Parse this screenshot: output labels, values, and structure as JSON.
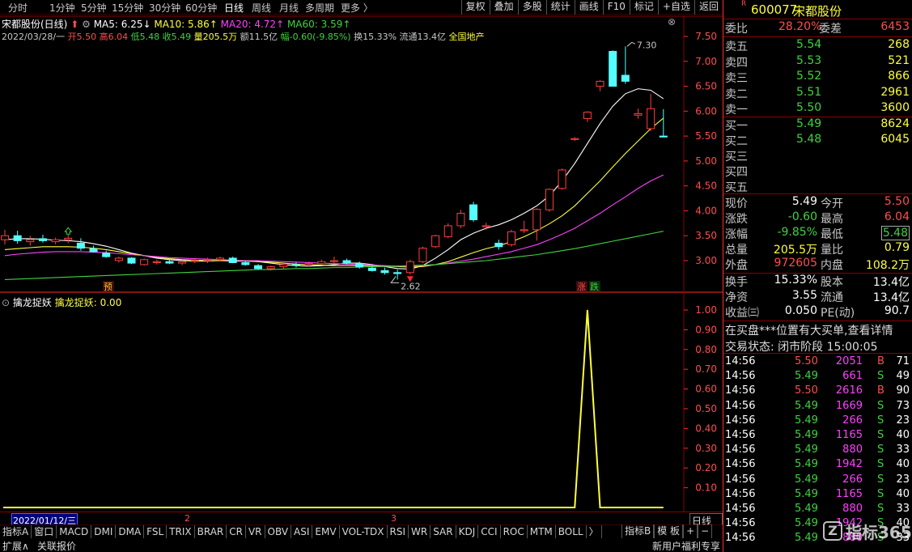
{
  "top_menu": {
    "items": [
      {
        "label": "分时"
      },
      {
        "label": "1分钟"
      },
      {
        "label": "5分钟"
      },
      {
        "label": "15分钟"
      },
      {
        "label": "30分钟"
      },
      {
        "label": "60分钟"
      },
      {
        "label": "日线"
      },
      {
        "label": "周线"
      },
      {
        "label": "月线"
      },
      {
        "label": "多周期"
      },
      {
        "label": "更多 〉"
      }
    ],
    "active": "日线",
    "buttons": [
      {
        "label": "复权"
      },
      {
        "label": "叠加"
      },
      {
        "label": "多股"
      },
      {
        "label": "统计"
      },
      {
        "label": "画线"
      },
      {
        "label": "F10"
      },
      {
        "label": "标记"
      },
      {
        "label": "+自选"
      },
      {
        "label": "返回"
      }
    ]
  },
  "stock_line": {
    "name": "宋都股份(日线)",
    "ma5": "MA5: 6.25↓",
    "ma10": "MA10: 5.86↑",
    "ma20": "MA20: 4.72↑",
    "ma60": "MA60: 3.59↑"
  },
  "ohlc_line": {
    "date": "2022/03/28/一",
    "open": "开5.50",
    "high": "高6.04",
    "low": "低5.48",
    "close": "收5.49",
    "volume": "量205.5万",
    "amount": "额11.5亿",
    "change": "幅-0.60(-9.85%)",
    "turnover": "换15.33%",
    "float": "流通13.4亿",
    "sector": "全国地产"
  },
  "price_axis": [
    "7.50",
    "7.00",
    "6.50",
    "6.00",
    "5.50",
    "5.00",
    "4.50",
    "4.00",
    "3.50",
    "3.00"
  ],
  "chart_labels": {
    "high": "7.30",
    "low": "2.62",
    "mark_pre": "预",
    "mark_zhang": "涨",
    "mark_die": "跌"
  },
  "indicator": {
    "title": "擒龙捉妖",
    "name": "擒龙捉妖:",
    "value": "0.00"
  },
  "indicator_axis": [
    "1.00",
    "0.90",
    "0.80",
    "0.70",
    "0.60",
    "0.50",
    "0.40",
    "0.30",
    "0.20",
    "0.10"
  ],
  "date_axis": {
    "cursor_date": "2022/01/12/三",
    "m2": "2",
    "m3": "3",
    "period": "日线板"
  },
  "tabs": [
    {
      "label": "指标A"
    },
    {
      "label": "窗口"
    },
    {
      "label": "MACD"
    },
    {
      "label": "DMI"
    },
    {
      "label": "DMA"
    },
    {
      "label": "FSL"
    },
    {
      "label": "TRIX"
    },
    {
      "label": "BRAR"
    },
    {
      "label": "CR"
    },
    {
      "label": "VR"
    },
    {
      "label": "OBV"
    },
    {
      "label": "ASI"
    },
    {
      "label": "EMV"
    },
    {
      "label": "VOL-TDX"
    },
    {
      "label": "RSI"
    },
    {
      "label": "WR"
    },
    {
      "label": "SAR"
    },
    {
      "label": "KDJ"
    },
    {
      "label": "CCI"
    },
    {
      "label": "ROC"
    },
    {
      "label": "MTM"
    },
    {
      "label": "BOLL"
    },
    {
      "label": "〉"
    }
  ],
  "tabs_right": [
    {
      "label": "指标B"
    },
    {
      "label": "模 板"
    },
    {
      "label": "+"
    },
    {
      "label": "−"
    }
  ],
  "footer": {
    "expand": "扩展∧",
    "related": "关联报价",
    "promo": "新用户福利专享"
  },
  "quote": {
    "flag": "R",
    "code": "600077",
    "name": "宋都股份",
    "weibi_label": "委比",
    "weibi": "28.20%",
    "weicha_label": "委差",
    "weicha": "6453",
    "asks": [
      {
        "label": "卖五",
        "price": "5.54",
        "vol": "268"
      },
      {
        "label": "卖四",
        "price": "5.53",
        "vol": "521"
      },
      {
        "label": "卖三",
        "price": "5.52",
        "vol": "866"
      },
      {
        "label": "卖二",
        "price": "5.51",
        "vol": "2961"
      },
      {
        "label": "卖一",
        "price": "5.50",
        "vol": "3600"
      }
    ],
    "bids": [
      {
        "label": "买一",
        "price": "5.49",
        "vol": "8624"
      },
      {
        "label": "买二",
        "price": "5.48",
        "vol": "6045"
      },
      {
        "label": "买三",
        "price": "",
        "vol": ""
      },
      {
        "label": "买四",
        "price": "",
        "vol": ""
      },
      {
        "label": "买五",
        "price": "",
        "vol": ""
      }
    ],
    "stats": [
      {
        "l1": "现价",
        "v1": "5.49",
        "l2": "今开",
        "v2": "5.50"
      },
      {
        "l1": "涨跌",
        "v1": "-0.60",
        "l2": "最高",
        "v2": "6.04"
      },
      {
        "l1": "涨幅",
        "v1": "-9.85%",
        "l2": "最低",
        "v2": "5.48"
      },
      {
        "l1": "总量",
        "v1": "205.5万",
        "l2": "量比",
        "v2": "0.79"
      },
      {
        "l1": "外盘",
        "v1": "972605",
        "l2": "内盘",
        "v2": "108.2万"
      }
    ],
    "stats2": [
      {
        "l1": "换手",
        "v1": "15.33%",
        "l2": "股本",
        "v2": "13.4亿"
      },
      {
        "l1": "净资",
        "v1": "3.55",
        "l2": "流通",
        "v2": "13.4亿"
      },
      {
        "l1": "收益㈢",
        "v1": "0.050",
        "l2": "PE(动)",
        "v2": "90.7"
      }
    ],
    "notice": "在买盘***位置有大买单,查看详情",
    "status": "交易状态: 闭市阶段 15:00:05"
  },
  "ticks": [
    {
      "t": "14:56",
      "p": "5.50",
      "v": "2051",
      "d": "B",
      "n": "71"
    },
    {
      "t": "14:56",
      "p": "5.49",
      "v": "661",
      "d": "S",
      "n": "49"
    },
    {
      "t": "14:56",
      "p": "5.50",
      "v": "2616",
      "d": "B",
      "n": "90"
    },
    {
      "t": "14:56",
      "p": "5.49",
      "v": "1669",
      "d": "S",
      "n": "73"
    },
    {
      "t": "14:56",
      "p": "5.49",
      "v": "266",
      "d": "S",
      "n": "23"
    },
    {
      "t": "14:56",
      "p": "5.49",
      "v": "1165",
      "d": "S",
      "n": "40"
    },
    {
      "t": "14:56",
      "p": "5.49",
      "v": "880",
      "d": "S",
      "n": "33"
    },
    {
      "t": "14:56",
      "p": "5.49",
      "v": "1942",
      "d": "S",
      "n": "40"
    },
    {
      "t": "14:56",
      "p": "5.49",
      "v": "266",
      "d": "S",
      "n": "23"
    },
    {
      "t": "14:56",
      "p": "5.49",
      "v": "1165",
      "d": "S",
      "n": "40"
    },
    {
      "t": "14:56",
      "p": "5.49",
      "v": "880",
      "d": "S",
      "n": "33"
    },
    {
      "t": "14:56",
      "p": "5.49",
      "v": "1942",
      "d": "S",
      "n": "40"
    },
    {
      "t": "14:56",
      "p": "5.49",
      "v": "880",
      "d": "S",
      "n": "33"
    }
  ],
  "watermark": "指标365",
  "chart_data": [
    {
      "type": "candlestick",
      "title": "宋都股份(日线)",
      "ylim": [
        2.5,
        7.6
      ],
      "candles": [
        {
          "o": 3.42,
          "h": 3.62,
          "l": 3.32,
          "c": 3.5
        },
        {
          "o": 3.5,
          "h": 3.6,
          "l": 3.34,
          "c": 3.4
        },
        {
          "o": 3.38,
          "h": 3.5,
          "l": 3.3,
          "c": 3.42
        },
        {
          "o": 3.44,
          "h": 3.52,
          "l": 3.36,
          "c": 3.4
        },
        {
          "o": 3.38,
          "h": 3.46,
          "l": 3.33,
          "c": 3.42
        },
        {
          "o": 3.42,
          "h": 3.52,
          "l": 3.35,
          "c": 3.45
        },
        {
          "o": 3.35,
          "h": 3.45,
          "l": 3.2,
          "c": 3.25
        },
        {
          "o": 3.24,
          "h": 3.3,
          "l": 3.16,
          "c": 3.18
        },
        {
          "o": 3.15,
          "h": 3.2,
          "l": 3.06,
          "c": 3.08
        },
        {
          "o": 3.0,
          "h": 3.08,
          "l": 2.96,
          "c": 3.05
        },
        {
          "o": 3.05,
          "h": 3.07,
          "l": 2.93,
          "c": 2.95
        },
        {
          "o": 2.92,
          "h": 3.04,
          "l": 2.9,
          "c": 3.02
        },
        {
          "o": 2.96,
          "h": 3.02,
          "l": 2.92,
          "c": 2.98
        },
        {
          "o": 2.98,
          "h": 3.01,
          "l": 2.93,
          "c": 2.95
        },
        {
          "o": 2.95,
          "h": 3.0,
          "l": 2.91,
          "c": 2.98
        },
        {
          "o": 2.98,
          "h": 3.05,
          "l": 2.95,
          "c": 3.0
        },
        {
          "o": 3.0,
          "h": 3.06,
          "l": 2.95,
          "c": 3.02
        },
        {
          "o": 3.02,
          "h": 3.08,
          "l": 2.98,
          "c": 3.05
        },
        {
          "o": 3.05,
          "h": 3.08,
          "l": 2.95,
          "c": 2.96
        },
        {
          "o": 2.96,
          "h": 3.0,
          "l": 2.9,
          "c": 2.92
        },
        {
          "o": 2.9,
          "h": 2.93,
          "l": 2.82,
          "c": 2.84
        },
        {
          "o": 2.84,
          "h": 2.9,
          "l": 2.8,
          "c": 2.88
        },
        {
          "o": 2.88,
          "h": 2.94,
          "l": 2.84,
          "c": 2.92
        },
        {
          "o": 2.92,
          "h": 2.97,
          "l": 2.86,
          "c": 2.9
        },
        {
          "o": 2.92,
          "h": 2.98,
          "l": 2.88,
          "c": 2.94
        },
        {
          "o": 2.94,
          "h": 3.02,
          "l": 2.92,
          "c": 2.98
        },
        {
          "o": 2.98,
          "h": 3.08,
          "l": 2.95,
          "c": 3.0
        },
        {
          "o": 3.0,
          "h": 3.04,
          "l": 2.92,
          "c": 2.95
        },
        {
          "o": 2.94,
          "h": 2.98,
          "l": 2.84,
          "c": 2.87
        },
        {
          "o": 2.85,
          "h": 2.9,
          "l": 2.78,
          "c": 2.8
        },
        {
          "o": 2.8,
          "h": 2.86,
          "l": 2.72,
          "c": 2.76
        },
        {
          "o": 2.76,
          "h": 2.82,
          "l": 2.62,
          "c": 2.75
        },
        {
          "o": 2.76,
          "h": 3.02,
          "l": 2.72,
          "c": 2.98
        },
        {
          "o": 2.98,
          "h": 3.28,
          "l": 2.95,
          "c": 3.25
        },
        {
          "o": 3.28,
          "h": 3.52,
          "l": 3.25,
          "c": 3.5
        },
        {
          "o": 3.48,
          "h": 3.75,
          "l": 3.45,
          "c": 3.7
        },
        {
          "o": 3.7,
          "h": 4.02,
          "l": 3.65,
          "c": 3.95
        },
        {
          "o": 4.12,
          "h": 4.18,
          "l": 3.78,
          "c": 3.82
        },
        {
          "o": 3.68,
          "h": 3.76,
          "l": 3.62,
          "c": 3.7
        },
        {
          "o": 3.35,
          "h": 3.42,
          "l": 3.22,
          "c": 3.28
        },
        {
          "o": 3.32,
          "h": 3.62,
          "l": 3.28,
          "c": 3.58
        },
        {
          "o": 3.6,
          "h": 3.8,
          "l": 3.55,
          "c": 3.62
        },
        {
          "o": 3.62,
          "h": 4.05,
          "l": 3.4,
          "c": 4.03
        },
        {
          "o": 4.02,
          "h": 4.45,
          "l": 3.98,
          "c": 4.43
        },
        {
          "o": 4.45,
          "h": 4.85,
          "l": 4.42,
          "c": 4.82
        },
        {
          "o": 5.45,
          "h": 5.48,
          "l": 5.4,
          "c": 5.45
        },
        {
          "o": 5.85,
          "h": 6.0,
          "l": 5.78,
          "c": 5.98
        },
        {
          "o": 6.5,
          "h": 6.62,
          "l": 6.4,
          "c": 6.6
        },
        {
          "o": 7.2,
          "h": 7.22,
          "l": 6.5,
          "c": 6.5
        },
        {
          "o": 6.72,
          "h": 7.3,
          "l": 6.55,
          "c": 6.6
        },
        {
          "o": 5.92,
          "h": 6.05,
          "l": 5.85,
          "c": 5.95
        },
        {
          "o": 5.65,
          "h": 6.35,
          "l": 5.6,
          "c": 6.05
        },
        {
          "o": 5.5,
          "h": 6.04,
          "l": 5.48,
          "c": 5.49
        }
      ],
      "series": [
        {
          "name": "MA5",
          "color": "#ffffff",
          "values": [
            3.42,
            3.44,
            3.44,
            3.43,
            3.41,
            3.4,
            3.38,
            3.34,
            3.29,
            3.22,
            3.15,
            3.1,
            3.05,
            3.02,
            3.0,
            2.99,
            2.99,
            3.0,
            3.0,
            3.0,
            2.98,
            2.95,
            2.92,
            2.9,
            2.89,
            2.9,
            2.92,
            2.95,
            2.95,
            2.92,
            2.88,
            2.84,
            2.83,
            2.9,
            3.05,
            3.22,
            3.42,
            3.55,
            3.65,
            3.72,
            3.82,
            3.95,
            4.1,
            4.3,
            4.6,
            4.95,
            5.35,
            5.75,
            6.1,
            6.35,
            6.45,
            6.42,
            6.25
          ]
        },
        {
          "name": "MA10",
          "color": "#ffff3c",
          "values": [
            3.22,
            3.24,
            3.26,
            3.28,
            3.28,
            3.28,
            3.27,
            3.25,
            3.22,
            3.18,
            3.14,
            3.1,
            3.07,
            3.04,
            3.02,
            3.01,
            3.0,
            3.0,
            2.99,
            2.99,
            2.98,
            2.97,
            2.95,
            2.93,
            2.92,
            2.91,
            2.9,
            2.9,
            2.9,
            2.9,
            2.89,
            2.88,
            2.87,
            2.88,
            2.92,
            2.98,
            3.07,
            3.16,
            3.24,
            3.3,
            3.38,
            3.48,
            3.6,
            3.74,
            3.9,
            4.1,
            4.35,
            4.6,
            4.88,
            5.15,
            5.4,
            5.65,
            5.86
          ]
        },
        {
          "name": "MA20",
          "color": "#ff40ff",
          "values": [
            3.1,
            3.13,
            3.15,
            3.17,
            3.18,
            3.18,
            3.18,
            3.17,
            3.16,
            3.14,
            3.12,
            3.1,
            3.08,
            3.06,
            3.05,
            3.04,
            3.03,
            3.02,
            3.01,
            3.0,
            3.0,
            2.99,
            2.98,
            2.97,
            2.96,
            2.95,
            2.94,
            2.93,
            2.92,
            2.91,
            2.9,
            2.89,
            2.89,
            2.9,
            2.92,
            2.95,
            2.99,
            3.03,
            3.08,
            3.13,
            3.18,
            3.25,
            3.32,
            3.42,
            3.53,
            3.65,
            3.8,
            3.95,
            4.12,
            4.28,
            4.45,
            4.6,
            4.72
          ]
        },
        {
          "name": "MA60",
          "color": "#3fd33f",
          "values": [
            2.62,
            2.63,
            2.64,
            2.65,
            2.66,
            2.67,
            2.68,
            2.69,
            2.7,
            2.71,
            2.72,
            2.73,
            2.74,
            2.75,
            2.76,
            2.77,
            2.78,
            2.79,
            2.8,
            2.81,
            2.82,
            2.82,
            2.83,
            2.84,
            2.84,
            2.85,
            2.86,
            2.86,
            2.87,
            2.88,
            2.88,
            2.89,
            2.9,
            2.91,
            2.92,
            2.94,
            2.96,
            2.98,
            3.0,
            3.03,
            3.06,
            3.09,
            3.12,
            3.16,
            3.2,
            3.24,
            3.29,
            3.34,
            3.39,
            3.44,
            3.49,
            3.54,
            3.59
          ]
        }
      ]
    },
    {
      "type": "line",
      "title": "擒龙捉妖",
      "ylim": [
        0,
        1.05
      ],
      "series": [
        {
          "name": "擒龙捉妖",
          "color": "#ffff3c",
          "values": [
            0,
            0,
            0,
            0,
            0,
            0,
            0,
            0,
            0,
            0,
            0,
            0,
            0,
            0,
            0,
            0,
            0,
            0,
            0,
            0,
            0,
            0,
            0,
            0,
            0,
            0,
            0,
            0,
            0,
            0,
            0,
            0,
            0,
            0,
            0,
            0,
            0,
            0,
            0,
            0,
            0,
            0,
            0,
            0,
            0,
            0,
            1,
            0,
            0,
            0,
            0,
            0,
            0
          ]
        }
      ]
    }
  ]
}
